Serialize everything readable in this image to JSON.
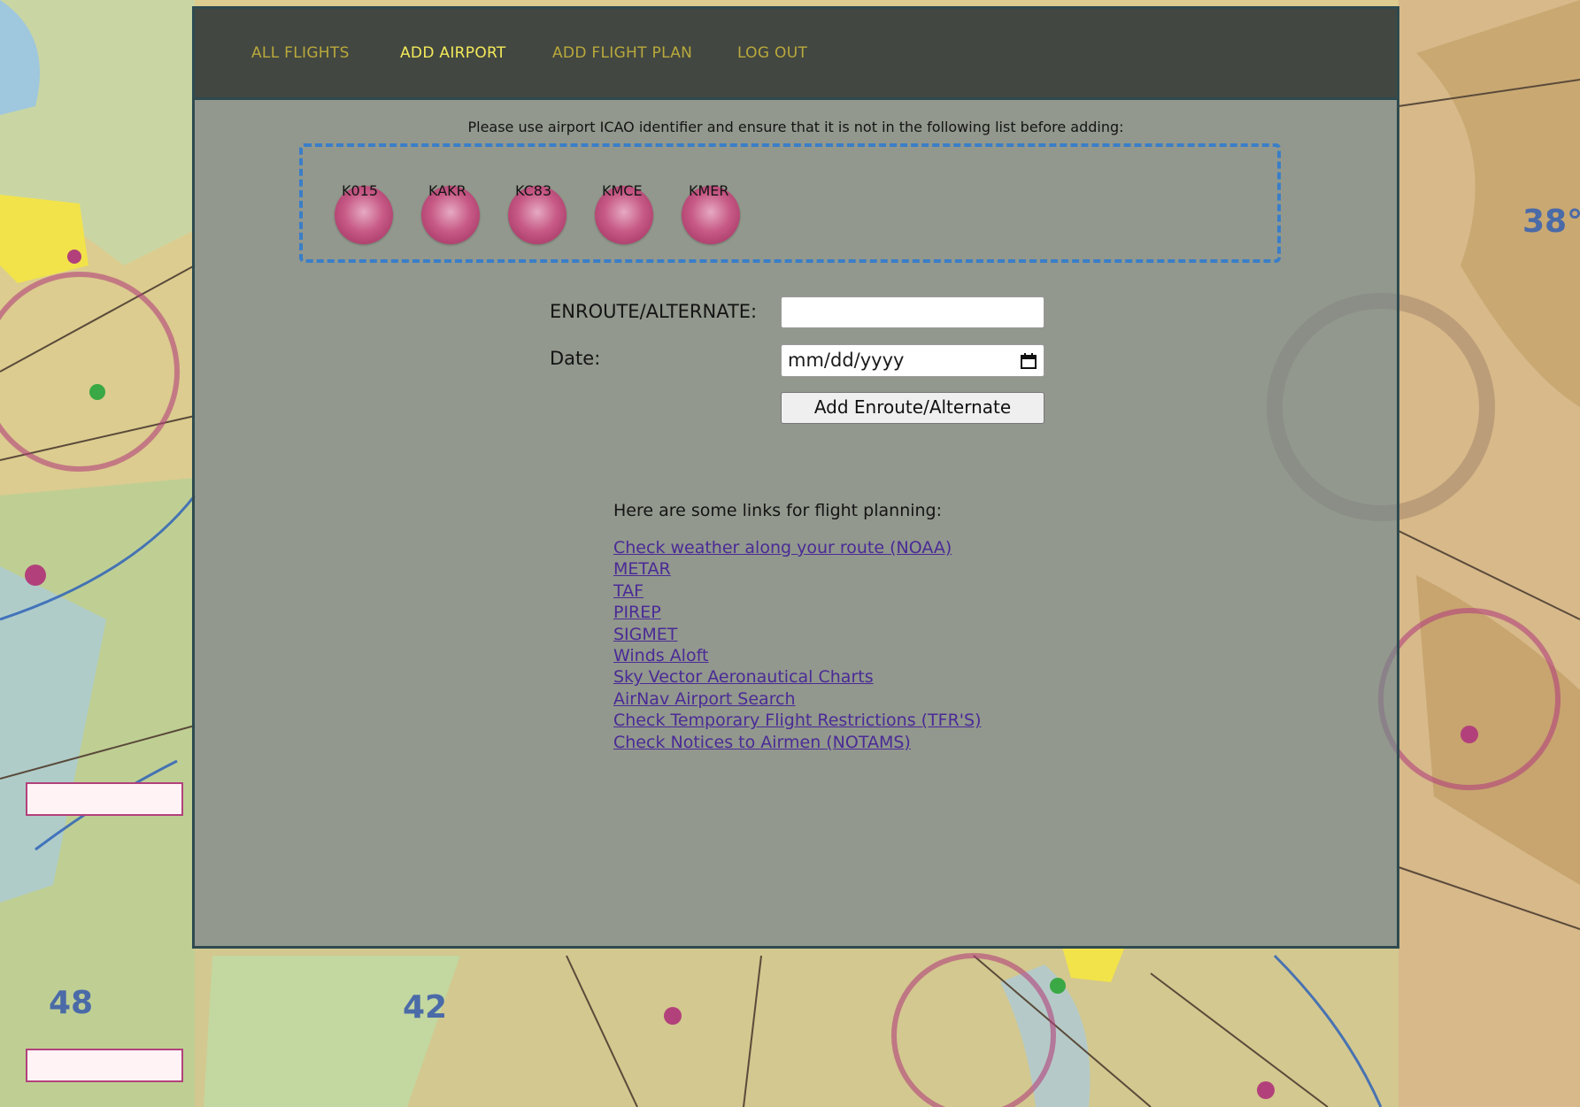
{
  "nav": {
    "items": [
      "ALL FLIGHTS",
      "ADD AIRPORT",
      "ADD FLIGHT PLAN",
      "LOG OUT"
    ],
    "active": "ADD AIRPORT"
  },
  "instruction": "Please use airport ICAO identifier and ensure that it is not in the following list before adding:",
  "airports": [
    "K015",
    "KAKR",
    "KC83",
    "KMCE",
    "KMER"
  ],
  "form": {
    "enroute_label": "ENROUTE/ALTERNATE:",
    "enroute_value": "",
    "date_label": "Date:",
    "date_placeholder": "mm/dd/yyyy",
    "submit_label": "Add Enroute/Alternate"
  },
  "links_section": {
    "heading": "Here are some links for flight planning:",
    "links": [
      "Check weather along your route (NOAA)",
      "METAR",
      "TAF",
      "PIREP",
      "SIGMET",
      "Winds Aloft",
      "Sky Vector Aeronautical Charts",
      "AirNav Airport Search",
      "Check Temporary Flight Restrictions (TFR'S)",
      "Check Notices to Airmen (NOTAMS)"
    ]
  },
  "colors": {
    "nav_text": "#b9a93c",
    "nav_active": "#f3ea5a",
    "dashed_border": "#3a7ec8",
    "bubble": "#c75a86",
    "link": "#4a2a96"
  },
  "icons": {
    "date_picker": "calendar-icon",
    "background": "sectional-chart-map"
  }
}
